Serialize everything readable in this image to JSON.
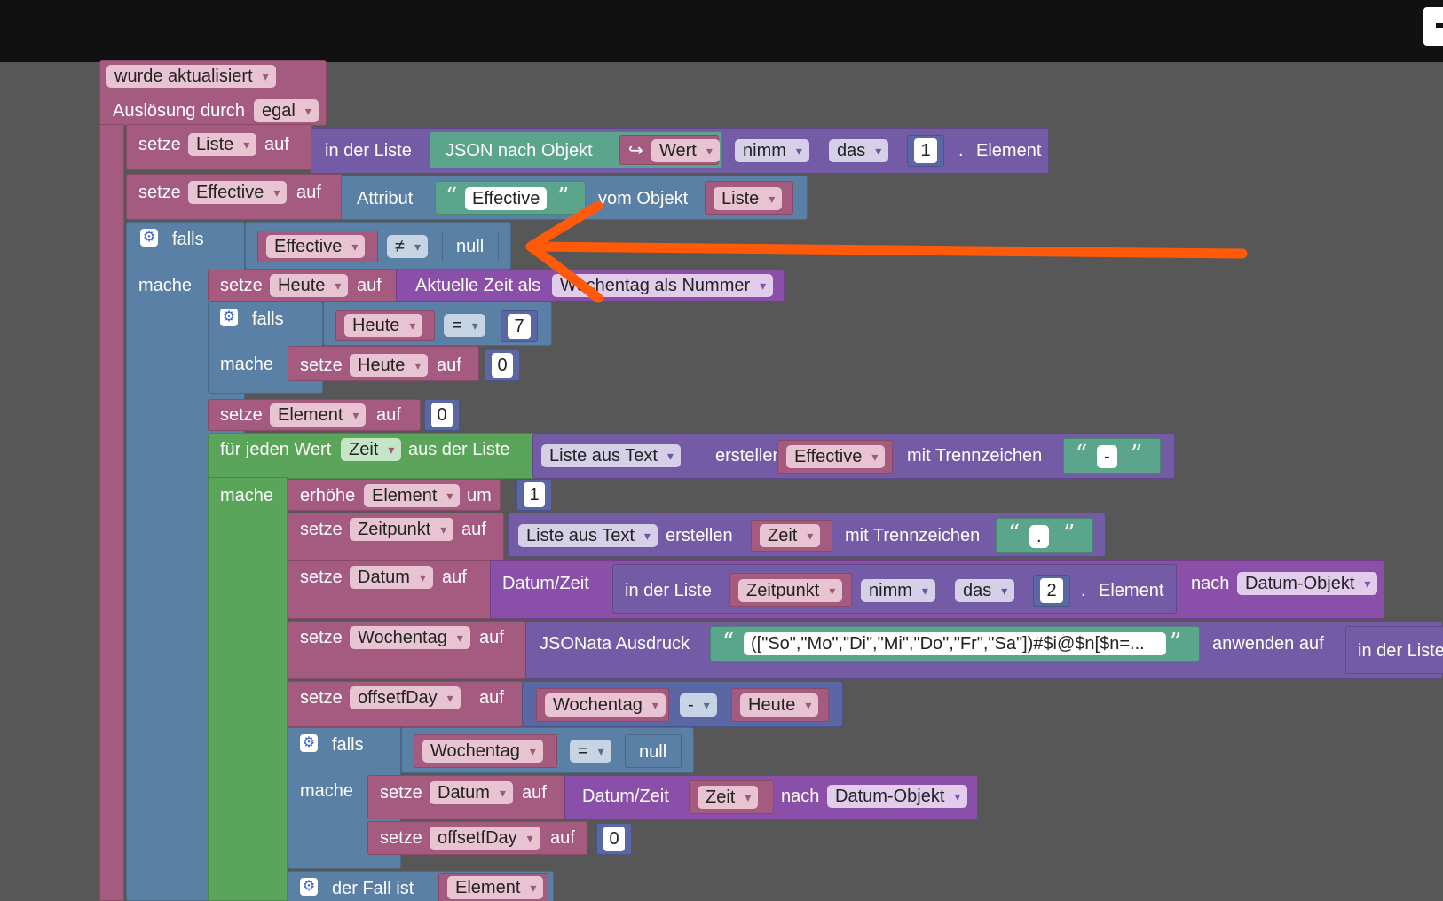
{
  "trigger": {
    "event": "wurde aktualisiert",
    "label_trigger": "Auslösung durch",
    "trigger_value": "egal"
  },
  "kw": {
    "set": "setze",
    "to": "auf",
    "if": "falls",
    "do": "mache",
    "for_each": "für jeden Wert",
    "from_list": "aus der Liste",
    "increase": "erhöhe",
    "by": "um",
    "switch": "der Fall ist"
  },
  "s1": {
    "var": "Liste",
    "in_list": "in der Liste",
    "json_to_obj": "JSON nach Objekt",
    "arrow": "↪",
    "value": "Wert",
    "take": "nimm",
    "the": "das",
    "index": "1",
    "dot": ".",
    "element": "Element"
  },
  "s2": {
    "var": "Effective",
    "attribute": "Attribut",
    "attr_name": "Effective",
    "from_obj": "vom Objekt",
    "obj": "Liste"
  },
  "if1": {
    "var": "Effective",
    "op": "≠",
    "rhs": "null"
  },
  "s3": {
    "var": "Heute",
    "current_time_as": "Aktuelle Zeit als",
    "format": "Wochentag als Nummer"
  },
  "if2": {
    "var": "Heute",
    "op": "=",
    "rhs": "7",
    "set_var": "Heute",
    "set_val": "0"
  },
  "s4": {
    "var": "Element",
    "val": "0"
  },
  "loop": {
    "var": "Zeit",
    "list_from_text": "Liste aus Text",
    "create": "erstellen",
    "text_var": "Effective",
    "with_sep": "mit Trennzeichen",
    "sep": "-"
  },
  "inc": {
    "var": "Element",
    "by": "1"
  },
  "s5": {
    "var": "Zeitpunkt",
    "list_from_text": "Liste aus Text",
    "create": "erstellen",
    "text_var": "Zeit",
    "with_sep": "mit Trennzeichen",
    "sep": "."
  },
  "s6": {
    "var": "Datum",
    "datetime": "Datum/Zeit",
    "in_list": "in der Liste",
    "list_var": "Zeitpunkt",
    "take": "nimm",
    "the": "das",
    "index": "2",
    "dot": ".",
    "element": "Element",
    "after": "nach",
    "target": "Datum-Objekt"
  },
  "s7": {
    "var": "Wochentag",
    "jsonata": "JSONata Ausdruck",
    "expr": "([\"So\",\"Mo\",\"Di\",\"Mi\",\"Do\",\"Fr\",\"Sa\"])#$i@$n[$n=...",
    "apply_to": "anwenden auf",
    "in_list": "in der Liste"
  },
  "s8": {
    "var": "offsetfDay",
    "lhs": "Wochentag",
    "op": "-",
    "rhs": "Heute"
  },
  "if3": {
    "var": "Wochentag",
    "op": "=",
    "rhs": "null"
  },
  "s9": {
    "var": "Datum",
    "datetime": "Datum/Zeit",
    "src": "Zeit",
    "after": "nach",
    "target": "Datum-Objekt"
  },
  "s10": {
    "var": "offsetfDay",
    "val": "0"
  },
  "sw": {
    "var": "Element"
  },
  "icons": {
    "gear": "gear-icon",
    "arrow": "annotation-arrow"
  },
  "colors": {
    "event": "#a55b80",
    "control": "#5b80a5",
    "loop": "#5ba55b",
    "list": "#745ba5",
    "text": "#5ba58c",
    "math": "#5b67a5",
    "datetime": "#8a4fa8",
    "annotation": "#ff5a0a"
  }
}
